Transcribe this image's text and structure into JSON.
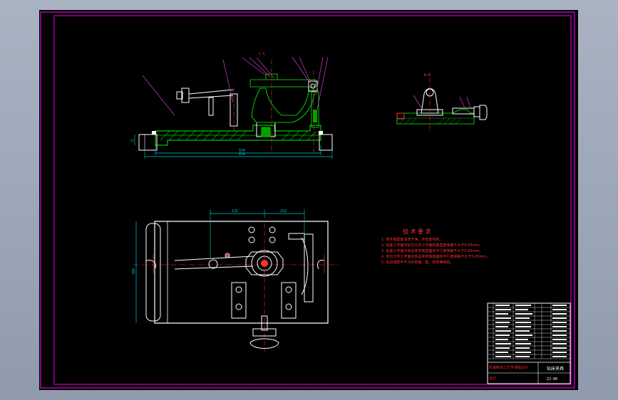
{
  "colors": {
    "frame": "#c000c0",
    "outline": "#ffffff",
    "part_green": "#00c000",
    "dim_cyan": "#00c8c8",
    "leader_magenta": "#d040d0",
    "centerline_red": "#ff3030",
    "note_red": "#ff3030",
    "table_line": "#ffffff",
    "title_red": "#ff2020"
  },
  "front_view": {
    "section_label": "C-C",
    "dim_overall": "614",
    "dim_inner": "554",
    "dim_side": "33"
  },
  "side_view": {
    "section_label": "B-B"
  },
  "plan_view": {
    "dim_left": "131",
    "dim_right": "252",
    "dim_vertical": "386"
  },
  "technical_requirements": {
    "title": "技 术 要 求",
    "items": [
      "1. 零件装配前清洗干净，并检查毛刺。",
      "2. 钻套工作面对定位元件工作面的垂直度误差不大于0.05mm。",
      "3. 钻套工作面对夹具体安装基面的平行度误差不大于0.05mm。",
      "4. 定位元件工作面对夹具体安装基面的平行度误差不大于0.05mm。",
      "5. 夹具装配中不允许有磕、碰、划伤等缺陷。"
    ]
  },
  "title_block": {
    "drawing_name": "钻床夹具",
    "drawing_no": "ZJ-00",
    "student": "设计",
    "school": "机械制造工艺学课程设计"
  }
}
